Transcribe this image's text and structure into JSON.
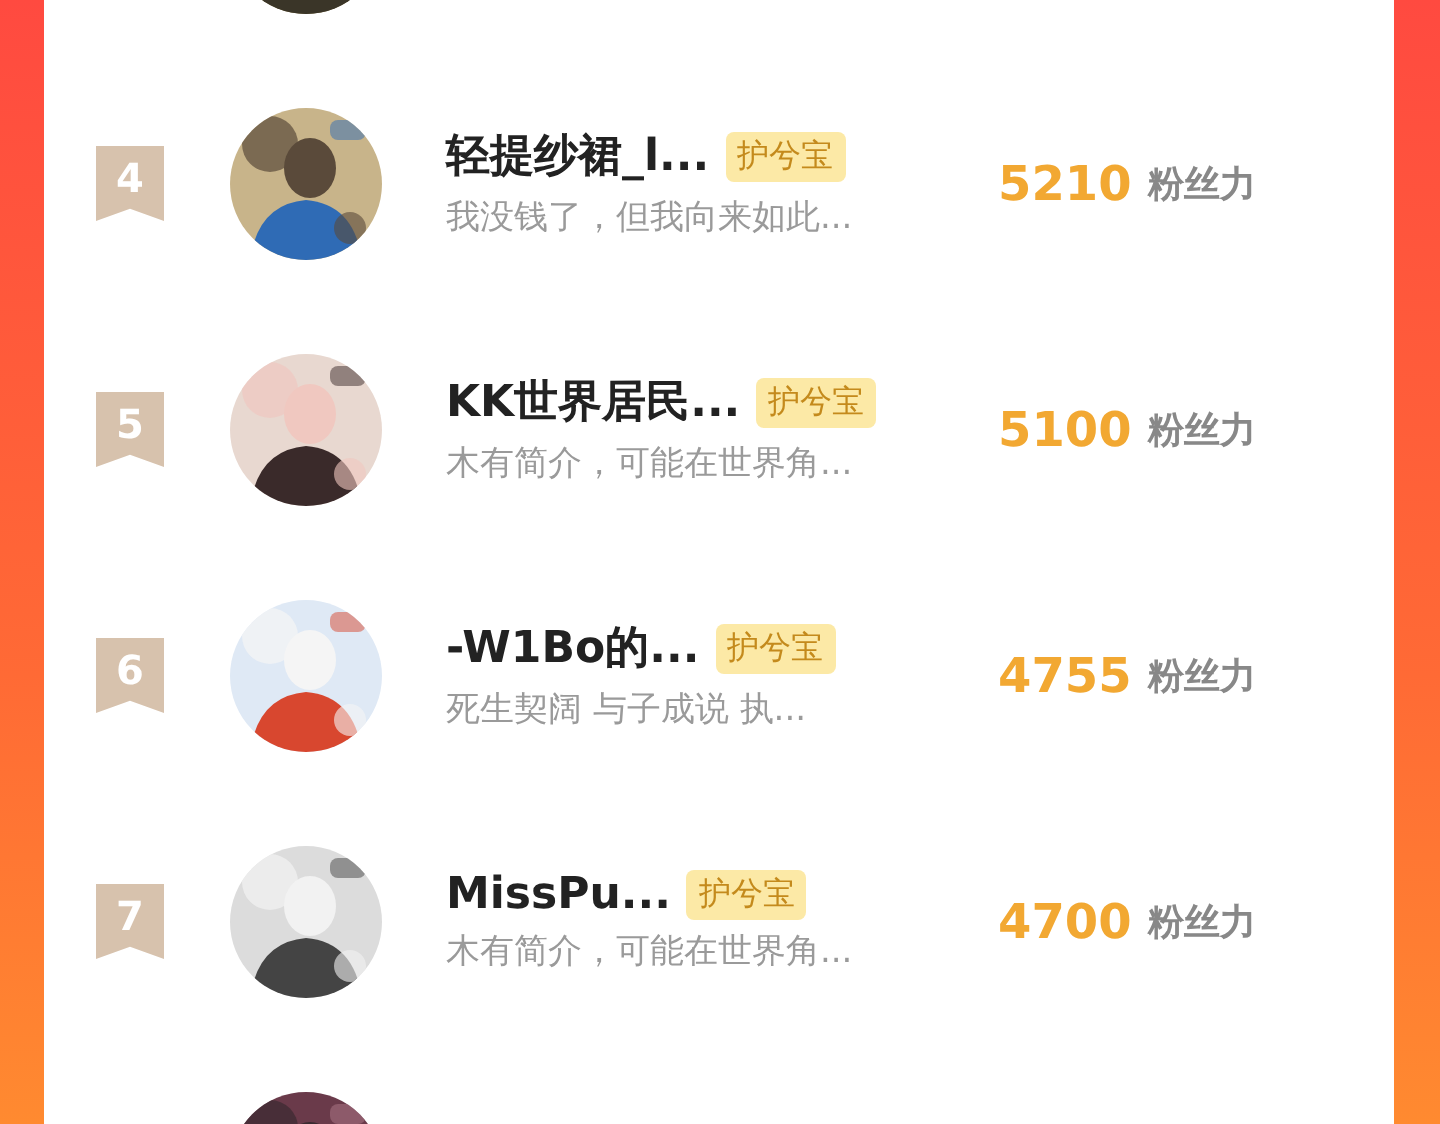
{
  "ranking": [
    {
      "kind": "partial"
    },
    {
      "kind": "row",
      "rank": "4",
      "name": "轻提纱裙_l...",
      "badge": "护兮宝",
      "bio": "我没钱了，但我向来如此...",
      "score": "5210",
      "score_unit": "粉丝力"
    },
    {
      "kind": "row",
      "rank": "5",
      "name": "KK世界居民...",
      "badge": "护兮宝",
      "bio": "木有简介，可能在世界角...",
      "score": "5100",
      "score_unit": "粉丝力"
    },
    {
      "kind": "row",
      "rank": "6",
      "name": "-W1Bo的...",
      "badge": "护兮宝",
      "bio": "死生契阔 与子成说 执...",
      "score": "4755",
      "score_unit": "粉丝力"
    },
    {
      "kind": "row",
      "rank": "7",
      "name": "MissPu...",
      "badge": "护兮宝",
      "bio": "木有简介，可能在世界角...",
      "score": "4700",
      "score_unit": "粉丝力"
    },
    {
      "kind": "partial"
    }
  ]
}
